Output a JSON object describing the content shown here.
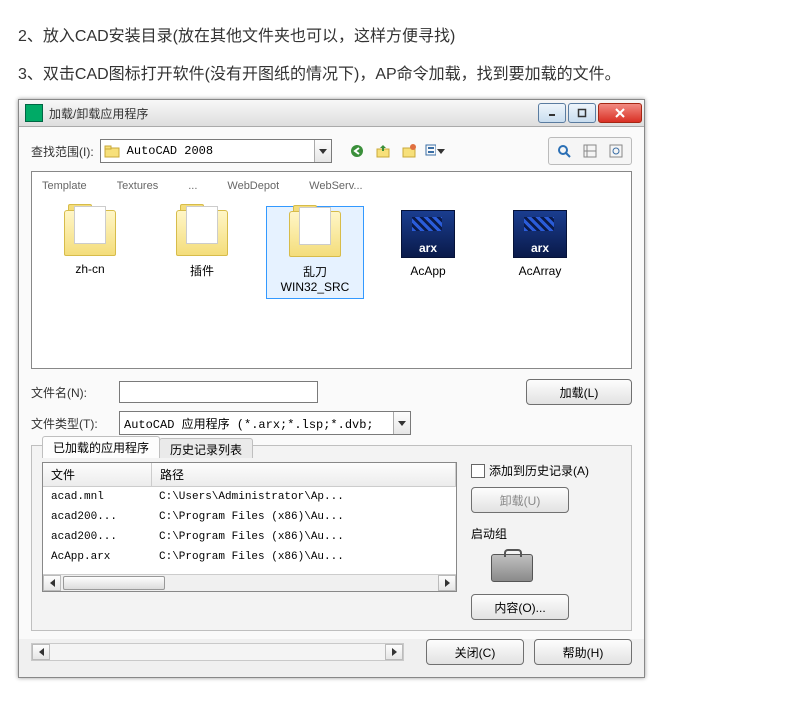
{
  "instructions": {
    "line2": "2、放入CAD安装目录(放在其他文件夹也可以，这样方便寻找)",
    "line3": "3、双击CAD图标打开软件(没有开图纸的情况下)，AP命令加载，找到要加载的文件。"
  },
  "dialog": {
    "title": "加载/卸载应用程序",
    "lookin_label": "查找范围(I):",
    "lookin_value": "AutoCAD 2008",
    "trunc_row": [
      "Template",
      "Textures",
      "...",
      "WebDepot",
      "WebServ..."
    ],
    "items": [
      {
        "label": "zh-cn",
        "type": "folder"
      },
      {
        "label": "插件",
        "type": "folder"
      },
      {
        "label": "乱刀WIN32_SRC",
        "type": "folder",
        "selected": true
      },
      {
        "label": "AcApp",
        "type": "arx"
      },
      {
        "label": "AcArray",
        "type": "arx"
      }
    ],
    "filename_label": "文件名(N):",
    "filename_value": "",
    "filetype_label": "文件类型(T):",
    "filetype_value": "AutoCAD 应用程序 (*.arx;*.lsp;*.dvb;",
    "load_btn": "加载(L)",
    "tabs": {
      "active": "已加载的应用程序",
      "inactive": "历史记录列表"
    },
    "add_history": "添加到历史记录(A)",
    "unload_btn": "卸载(U)",
    "startup_label": "启动组",
    "contents_btn": "内容(O)...",
    "list": {
      "col_file": "文件",
      "col_path": "路径",
      "rows": [
        {
          "f": "acad.mnl",
          "p": "C:\\Users\\Administrator\\Ap..."
        },
        {
          "f": "acad200...",
          "p": "C:\\Program Files (x86)\\Au..."
        },
        {
          "f": "acad200...",
          "p": "C:\\Program Files (x86)\\Au..."
        },
        {
          "f": "AcApp.arx",
          "p": "C:\\Program Files (x86)\\Au..."
        }
      ]
    },
    "close_btn": "关闭(C)",
    "help_btn": "帮助(H)"
  }
}
